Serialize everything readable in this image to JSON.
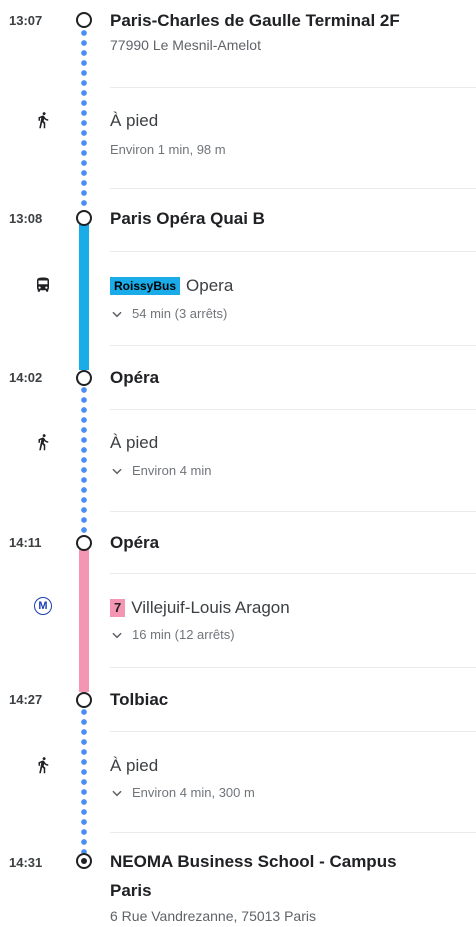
{
  "colors": {
    "walk_dots": "#4a8df6",
    "bus_line": "#1aace8",
    "metro_line": "#f395b3",
    "text_primary": "#202124",
    "text_secondary": "#70757a"
  },
  "stops": [
    {
      "time": "13:07",
      "name": "Paris-Charles de Gaulle Terminal 2F",
      "address": "77990 Le Mesnil-Amelot"
    },
    {
      "time": "13:08",
      "name": "Paris Opéra Quai B"
    },
    {
      "time": "14:02",
      "name": "Opéra"
    },
    {
      "time": "14:11",
      "name": "Opéra"
    },
    {
      "time": "14:27",
      "name": "Tolbiac"
    },
    {
      "time": "14:31",
      "name_line1": "NEOMA Business School - Campus",
      "name_line2": "Paris",
      "address": "6 Rue Vandrezanne, 75013 Paris"
    }
  ],
  "walks": [
    {
      "label": "À pied",
      "detail": "Environ 1 min, 98 m",
      "icon": "walking-icon"
    },
    {
      "label": "À pied",
      "detail": "Environ 4 min",
      "icon": "walking-icon"
    },
    {
      "label": "À pied",
      "detail": "Environ 4 min, 300 m",
      "icon": "walking-icon"
    }
  ],
  "transit": [
    {
      "icon": "bus-icon",
      "badge": "RoissyBus",
      "direction": "Opera",
      "detail": "54 min (3 arrêts)"
    },
    {
      "icon": "metro-icon",
      "metro_symbol": "M",
      "badge": "7",
      "direction": "Villejuif-Louis Aragon",
      "detail": "16 min (12 arrêts)"
    }
  ]
}
